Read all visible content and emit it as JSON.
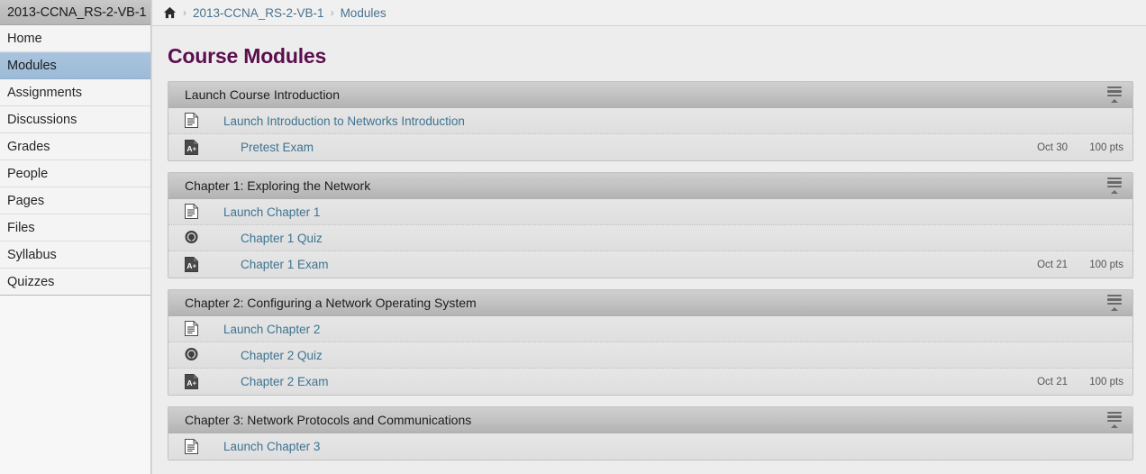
{
  "sidebar": {
    "course_title": "2013-CCNA_RS-2-VB-1",
    "items": [
      {
        "label": "Home",
        "active": false
      },
      {
        "label": "Modules",
        "active": true
      },
      {
        "label": "Assignments",
        "active": false
      },
      {
        "label": "Discussions",
        "active": false
      },
      {
        "label": "Grades",
        "active": false
      },
      {
        "label": "People",
        "active": false
      },
      {
        "label": "Pages",
        "active": false
      },
      {
        "label": "Files",
        "active": false
      },
      {
        "label": "Syllabus",
        "active": false
      },
      {
        "label": "Quizzes",
        "active": false
      }
    ]
  },
  "breadcrumb": {
    "home_icon": "home-icon",
    "separator": "›",
    "items": [
      {
        "label": "2013-CCNA_RS-2-VB-1"
      },
      {
        "label": "Modules"
      }
    ]
  },
  "page": {
    "title": "Course Modules",
    "title_color": "#5c0f4e",
    "link_color": "#3d7491"
  },
  "modules": [
    {
      "name": "Launch Course Introduction",
      "collapse_icon": "collapse-module-icon",
      "items": [
        {
          "icon": "page-icon",
          "title": "Launch Introduction to Networks Introduction",
          "indent": 0,
          "due": "",
          "points": ""
        },
        {
          "icon": "assignment-icon",
          "title": "Pretest Exam",
          "indent": 1,
          "due": "Oct 30",
          "points": "100 pts"
        }
      ]
    },
    {
      "name": "Chapter 1: Exploring the Network",
      "collapse_icon": "collapse-module-icon",
      "items": [
        {
          "icon": "page-icon",
          "title": "Launch Chapter 1",
          "indent": 0,
          "due": "",
          "points": ""
        },
        {
          "icon": "quiz-icon",
          "title": "Chapter 1 Quiz",
          "indent": 1,
          "due": "",
          "points": ""
        },
        {
          "icon": "assignment-icon",
          "title": "Chapter 1 Exam",
          "indent": 1,
          "due": "Oct 21",
          "points": "100 pts"
        }
      ]
    },
    {
      "name": "Chapter 2: Configuring a Network Operating System",
      "collapse_icon": "collapse-module-icon",
      "items": [
        {
          "icon": "page-icon",
          "title": "Launch Chapter 2",
          "indent": 0,
          "due": "",
          "points": ""
        },
        {
          "icon": "quiz-icon",
          "title": "Chapter 2 Quiz",
          "indent": 1,
          "due": "",
          "points": ""
        },
        {
          "icon": "assignment-icon",
          "title": "Chapter 2 Exam",
          "indent": 1,
          "due": "Oct 21",
          "points": "100 pts"
        }
      ]
    },
    {
      "name": "Chapter 3: Network Protocols and Communications",
      "collapse_icon": "collapse-module-icon",
      "items": [
        {
          "icon": "page-icon",
          "title": "Launch Chapter 3",
          "indent": 0,
          "due": "",
          "points": ""
        }
      ]
    }
  ]
}
